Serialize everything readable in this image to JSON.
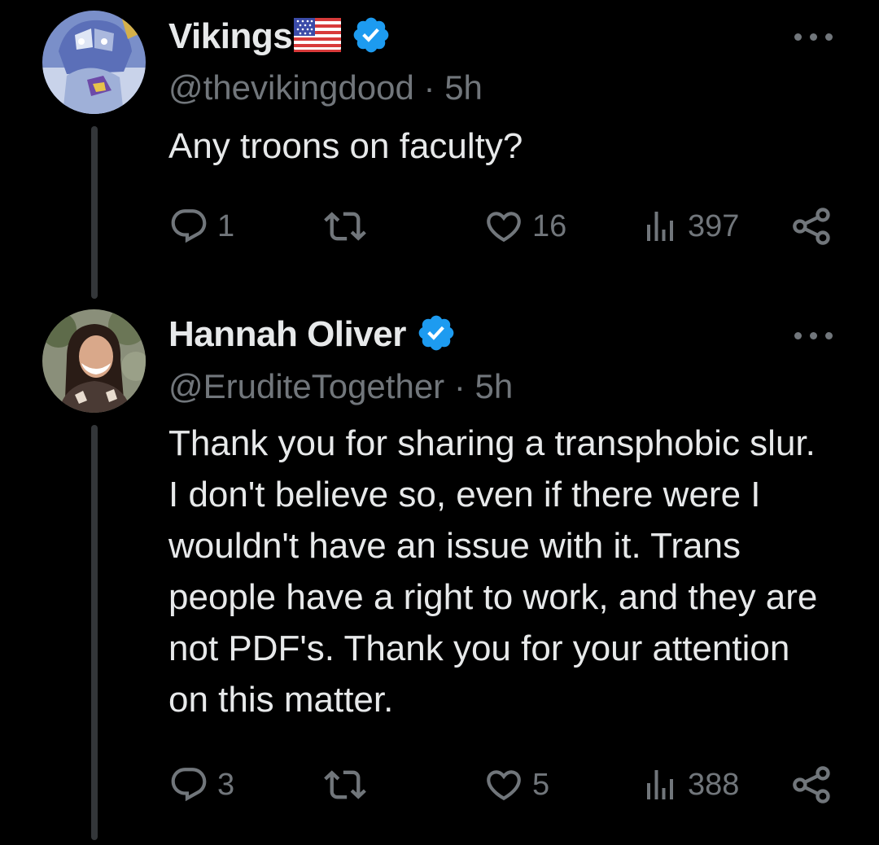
{
  "tweets": [
    {
      "display_name": "Vikings",
      "has_flag": true,
      "verified": true,
      "handle": "@thevikingdood",
      "separator": "·",
      "time": "5h",
      "text": "Any troons on faculty?",
      "stats": {
        "replies": "1",
        "retweets": "",
        "likes": "16",
        "views": "397"
      },
      "avatar_icon": "robot-viking-avatar"
    },
    {
      "display_name": "Hannah Oliver",
      "has_flag": false,
      "verified": true,
      "handle": "@EruditeTogether",
      "separator": "·",
      "time": "5h",
      "text": "Thank you for sharing a transphobic slur. I don't believe so, even if there were I wouldn't have an issue with it. Trans people have a right to work, and they are not PDF's. Thank you for your attention on this matter.",
      "stats": {
        "replies": "3",
        "retweets": "",
        "likes": "5",
        "views": "388"
      },
      "avatar_icon": "woman-portrait-avatar"
    }
  ],
  "colors": {
    "background": "#000000",
    "primary_text": "#e7e9ea",
    "secondary_text": "#71767b",
    "verified_blue": "#1d9bf0",
    "thread_line": "#333639"
  },
  "icons": [
    "reply-icon",
    "retweet-icon",
    "like-icon",
    "views-icon",
    "share-icon",
    "more-icon",
    "verified-badge-icon",
    "us-flag-icon"
  ]
}
